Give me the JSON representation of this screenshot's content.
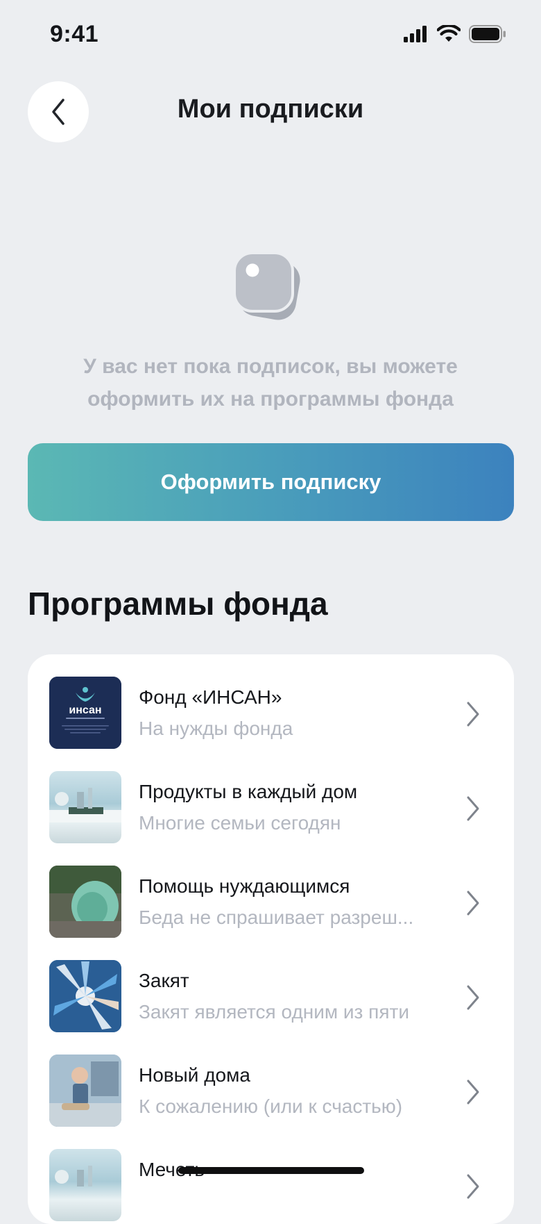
{
  "status": {
    "time": "9:41"
  },
  "header": {
    "title": "Мои подписки"
  },
  "empty_state": {
    "message": "У вас нет пока подписок, вы можете оформить их на программы фонда"
  },
  "actions": {
    "subscribe_label": "Оформить подписку"
  },
  "programs": {
    "title": "Программы фонда",
    "items": [
      {
        "title": "Фонд «ИНСАН»",
        "subtitle": "На нужды фонда",
        "logo_text": "инсан"
      },
      {
        "title": "Продукты в каждый дом",
        "subtitle": "Многие семьи сегодян"
      },
      {
        "title": "Помощь нуждающимся",
        "subtitle": "Беда не спрашивает разреш..."
      },
      {
        "title": "Закят",
        "subtitle": "Закят является одним из пяти"
      },
      {
        "title": "Новый дома",
        "subtitle": "К сожалению (или к счастью)"
      },
      {
        "title": "Мечеть",
        "subtitle": ""
      }
    ]
  },
  "colors": {
    "background": "#ECEEF1",
    "button_gradient_start": "#5BB8B4",
    "button_gradient_end": "#3C82BE",
    "muted_text": "#B3B7C0"
  }
}
